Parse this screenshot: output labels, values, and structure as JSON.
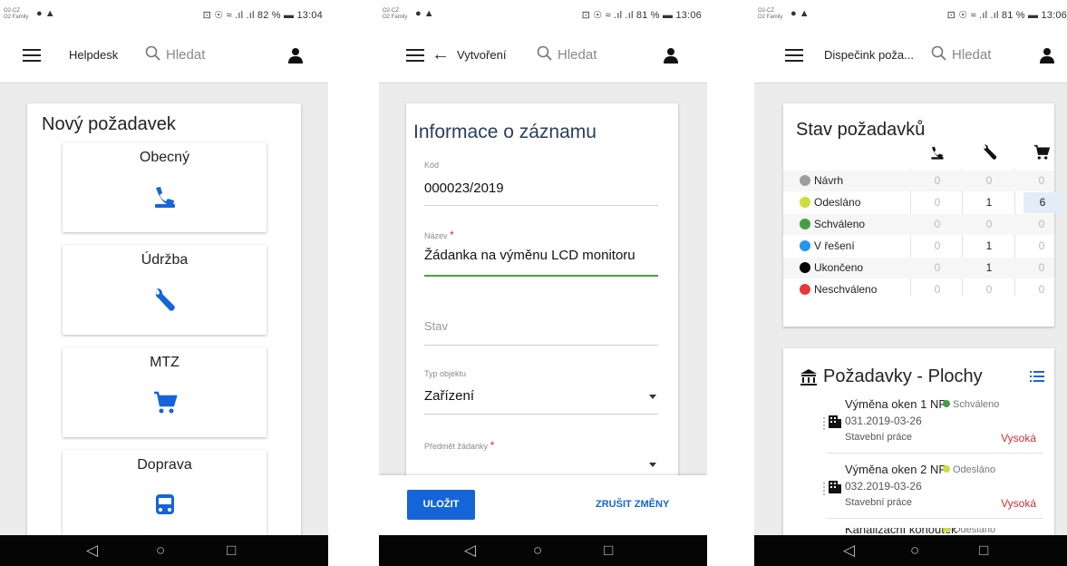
{
  "status_bars": [
    {
      "carrier": "O2-CZ\nO2 Family",
      "right": "⊡ ☉ ≈ .ıl .ıl 82 % ▬ 13:04"
    },
    {
      "carrier": "O2-CZ\nO2 Family",
      "right": "⊡ ☉ ≈ .ıl .ıl 81 % ▬ 13:06"
    },
    {
      "carrier": "O2-CZ\nO2 Family",
      "right": "⊡ ☉ ≈ .ıl .ıl 81 % ▬ 13:06"
    }
  ],
  "search": {
    "placeholder": "Hledat"
  },
  "screen1": {
    "app_title": "Helpdesk",
    "card_title": "Nový požadavek",
    "tiles": [
      {
        "label": "Obecný",
        "icon": "support-agent-icon"
      },
      {
        "label": "Údržba",
        "icon": "wrench-icon"
      },
      {
        "label": "MTZ",
        "icon": "cart-icon"
      },
      {
        "label": "Doprava",
        "icon": "bus-icon"
      }
    ]
  },
  "screen2": {
    "app_title": "Vytvoření",
    "card_title": "Informace o záznamu",
    "fields": {
      "code_label": "Kód",
      "code_value": "000023/2019",
      "name_label": "Název",
      "name_value": "Žádanka na výměnu LCD monitoru",
      "state_placeholder": "Stav",
      "object_type_label": "Typ objektu",
      "object_type_value": "Zařízení",
      "subject_label": "Předmět žádanky",
      "required_marker": "*"
    },
    "save_label": "ULOŽIT",
    "cancel_label": "ZRUŠIT ZMĚNY"
  },
  "screen3": {
    "app_title": "Dispečink poža...",
    "status_card_title": "Stav požadavků",
    "status_columns": [
      "support-agent-icon",
      "wrench-icon",
      "cart-icon"
    ],
    "status_rows": [
      {
        "name": "Návrh",
        "color": "#9e9e9e",
        "values": [
          "0",
          "0",
          "0"
        ]
      },
      {
        "name": "Odesláno",
        "color": "#cddc39",
        "values": [
          "0",
          "1",
          "6"
        ]
      },
      {
        "name": "Schváleno",
        "color": "#43a047",
        "values": [
          "0",
          "0",
          "0"
        ]
      },
      {
        "name": "V řešení",
        "color": "#2196f3",
        "values": [
          "0",
          "1",
          "0"
        ]
      },
      {
        "name": "Ukončeno",
        "color": "#000000",
        "values": [
          "0",
          "1",
          "0"
        ]
      },
      {
        "name": "Neschváleno",
        "color": "#e53935",
        "values": [
          "0",
          "0",
          "0"
        ]
      }
    ],
    "requests_card_title": "Požadavky - Plochy",
    "requests": [
      {
        "title": "Výměna oken 1 NP",
        "status": "Schváleno",
        "status_color": "#43a047",
        "code": "031.2019-03-26",
        "category": "Stavební práce",
        "priority": "Vysoká"
      },
      {
        "title": "Výměna oken 2 NP",
        "status": "Odesláno",
        "status_color": "#cddc39",
        "code": "032.2019-03-26",
        "category": "Stavební práce",
        "priority": "Vysoká"
      },
      {
        "title": "Kanalizační kohoutek",
        "status": "Odesláno",
        "status_color": "#cddc39"
      }
    ]
  },
  "colors": {
    "accent": "#1565d8",
    "focus_underline": "#43a047",
    "required": "#d32f2f"
  }
}
